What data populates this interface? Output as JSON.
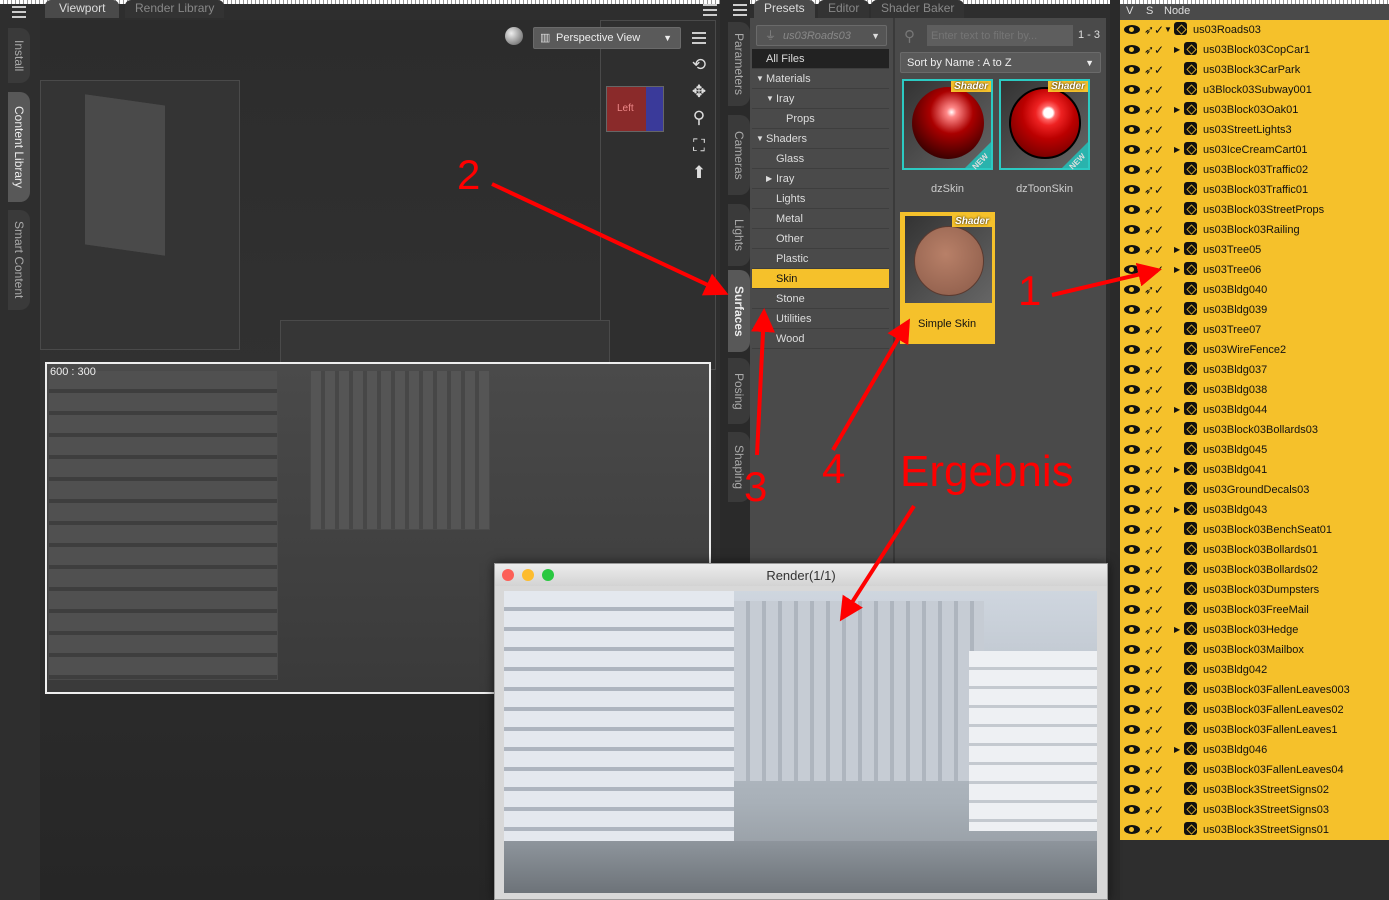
{
  "left_tabs": [
    "Install",
    "Content Library",
    "Smart Content"
  ],
  "viewport": {
    "tabs": [
      "Viewport",
      "Render Library"
    ],
    "camera": "Perspective View",
    "frame_label": "600 : 300",
    "cube_label": "Left"
  },
  "pane_tabs": [
    "Parameters",
    "Cameras",
    "Lights",
    "Surfaces",
    "Posing",
    "Shaping"
  ],
  "surfaces": {
    "tabs": [
      "Presets",
      "Editor",
      "Shader Baker"
    ],
    "filter_node": "us03Roads03",
    "search_placeholder": "Enter text to filter by...",
    "count": "1 - 3",
    "sort": "Sort by Name : A to Z",
    "tree": [
      {
        "label": "All Files",
        "level": 0,
        "arrow": ""
      },
      {
        "label": "Materials",
        "level": 0,
        "arrow": "▼"
      },
      {
        "label": "Iray",
        "level": 1,
        "arrow": "▼"
      },
      {
        "label": "Props",
        "level": 2,
        "arrow": ""
      },
      {
        "label": "Shaders",
        "level": 0,
        "arrow": "▼"
      },
      {
        "label": "Glass",
        "level": 1,
        "arrow": ""
      },
      {
        "label": "Iray",
        "level": 1,
        "arrow": "▶"
      },
      {
        "label": "Lights",
        "level": 1,
        "arrow": ""
      },
      {
        "label": "Metal",
        "level": 1,
        "arrow": ""
      },
      {
        "label": "Other",
        "level": 1,
        "arrow": ""
      },
      {
        "label": "Plastic",
        "level": 1,
        "arrow": ""
      },
      {
        "label": "Skin",
        "level": 1,
        "arrow": "",
        "selected": true
      },
      {
        "label": "Stone",
        "level": 1,
        "arrow": ""
      },
      {
        "label": "Utilities",
        "level": 1,
        "arrow": ""
      },
      {
        "label": "Wood",
        "level": 1,
        "arrow": ""
      }
    ],
    "presets": [
      {
        "name": "dzSkin",
        "badge": "Shader",
        "new": "NEW"
      },
      {
        "name": "dzToonSkin",
        "badge": "Shader",
        "new": "NEW"
      },
      {
        "name": "Simple Skin",
        "badge": "Shader",
        "selected": true
      }
    ]
  },
  "scene": {
    "headers": [
      "V",
      "S",
      "Node"
    ],
    "nodes": [
      {
        "name": "us03Roads03",
        "root": true
      },
      {
        "name": "us03Block03CopCar1",
        "expand": true
      },
      {
        "name": "us03Block3CarPark"
      },
      {
        "name": "u3Block03Subway001"
      },
      {
        "name": "us03Block03Oak01",
        "expand": true
      },
      {
        "name": "us03StreetLights3"
      },
      {
        "name": "us03IceCreamCart01",
        "expand": true
      },
      {
        "name": "us03Block03Traffic02"
      },
      {
        "name": "us03Block03Traffic01"
      },
      {
        "name": "us03Block03StreetProps"
      },
      {
        "name": "us03Block03Railing"
      },
      {
        "name": "us03Tree05",
        "expand": true
      },
      {
        "name": "us03Tree06",
        "expand": true
      },
      {
        "name": "us03Bldg040"
      },
      {
        "name": "us03Bldg039"
      },
      {
        "name": "us03Tree07"
      },
      {
        "name": "us03WireFence2"
      },
      {
        "name": "us03Bldg037"
      },
      {
        "name": "us03Bldg038"
      },
      {
        "name": "us03Bldg044",
        "expand": true
      },
      {
        "name": "us03Block03Bollards03"
      },
      {
        "name": "us03Bldg045"
      },
      {
        "name": "us03Bldg041",
        "expand": true
      },
      {
        "name": "us03GroundDecals03"
      },
      {
        "name": "us03Bldg043",
        "expand": true
      },
      {
        "name": "us03Block03BenchSeat01"
      },
      {
        "name": "us03Block03Bollards01"
      },
      {
        "name": "us03Block03Bollards02"
      },
      {
        "name": "us03Block03Dumpsters"
      },
      {
        "name": "us03Block03FreeMail"
      },
      {
        "name": "us03Block03Hedge",
        "expand": true
      },
      {
        "name": "us03Block03Mailbox"
      },
      {
        "name": "us03Bldg042"
      },
      {
        "name": "us03Block03FallenLeaves003"
      },
      {
        "name": "us03Block03FallenLeaves02"
      },
      {
        "name": "us03Block03FallenLeaves1"
      },
      {
        "name": "us03Bldg046",
        "expand": true
      },
      {
        "name": "us03Block03FallenLeaves04"
      },
      {
        "name": "us03Block3StreetSigns02"
      },
      {
        "name": "us03Block3StreetSigns03"
      },
      {
        "name": "us03Block3StreetSigns01"
      }
    ]
  },
  "render_window": {
    "title": "Render(1/1)"
  },
  "annotations": {
    "n1": "1",
    "n2": "2",
    "n3": "3",
    "n4": "4",
    "result": "Ergebnis"
  },
  "colors": {
    "accent": "#f5c12b",
    "annotation": "#ff0000",
    "new_badge": "#2ccac2"
  }
}
